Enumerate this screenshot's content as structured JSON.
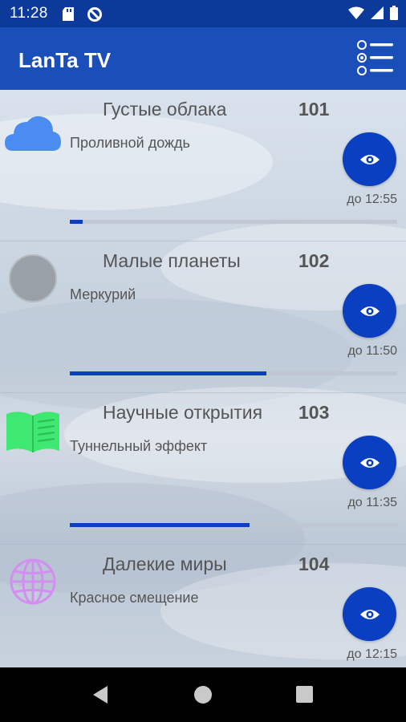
{
  "status_bar": {
    "time": "11:28",
    "icons": [
      "sd-card-icon",
      "sync-icon",
      "wifi-icon",
      "signal-icon",
      "battery-icon"
    ]
  },
  "app_bar": {
    "title": "LanTa TV",
    "menu_icon": "list-menu-icon"
  },
  "colors": {
    "accent": "#0a3fc2",
    "app_bar": "#1a4fba",
    "status_bar": "#0b3a9a"
  },
  "channels": [
    {
      "name": "Густые облака",
      "number": "101",
      "program": "Проливной дождь",
      "end_time": "до 12:55",
      "progress": 0.04,
      "icon": "cloud-icon",
      "icon_color": "#4a8cf0"
    },
    {
      "name": "Малые планеты",
      "number": "102",
      "program": "Меркурий",
      "end_time": "до 11:50",
      "progress": 0.6,
      "icon": "planet-icon",
      "icon_color": "#9aa0a8"
    },
    {
      "name": "Научные открытия",
      "number": "103",
      "program": "Туннельный эффект",
      "end_time": "до 11:35",
      "progress": 0.55,
      "icon": "book-icon",
      "icon_color": "#3fe870"
    },
    {
      "name": "Далекие миры",
      "number": "104",
      "program": "Красное смещение",
      "end_time": "до 12:15",
      "progress": 0.0,
      "icon": "globe-icon",
      "icon_color": "#d28ef0"
    }
  ],
  "nav_bar": {
    "buttons": [
      "back-icon",
      "home-icon",
      "recent-apps-icon"
    ]
  }
}
